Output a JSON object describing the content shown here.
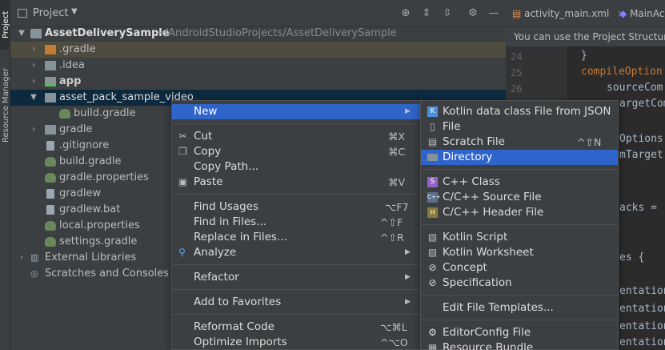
{
  "side_strip": {
    "project_tab": "Project",
    "resource_manager_tab": "Resource Manager"
  },
  "project_panel": {
    "title": "Project",
    "dropdown_icon": "chevron-down-icon",
    "header_icons": [
      "locate-icon",
      "expand-all-icon",
      "collapse-all-icon",
      "gear-icon",
      "hide-icon"
    ],
    "root": {
      "label": "AssetDeliverySample",
      "path": "~/AndroidStudioProjects/AssetDeliverySample"
    },
    "items": [
      {
        "label": ".gradle",
        "icon": "folder-icon"
      },
      {
        "label": ".idea",
        "icon": "folder-icon"
      },
      {
        "label": "app",
        "icon": "module-folder-icon"
      },
      {
        "label": "asset_pack_sample_video",
        "icon": "folder-icon"
      },
      {
        "label": "build.gradle",
        "icon": "gradle-icon"
      },
      {
        "label": "gradle",
        "icon": "folder-icon"
      },
      {
        "label": ".gitignore",
        "icon": "file-icon"
      },
      {
        "label": "build.gradle",
        "icon": "gradle-icon"
      },
      {
        "label": "gradle.properties",
        "icon": "gradle-icon"
      },
      {
        "label": "gradlew",
        "icon": "file-icon"
      },
      {
        "label": "gradlew.bat",
        "icon": "file-icon"
      },
      {
        "label": "local.properties",
        "icon": "gradle-icon"
      },
      {
        "label": "settings.gradle",
        "icon": "gradle-icon"
      },
      {
        "label": "External Libraries",
        "icon": "libraries-icon"
      },
      {
        "label": "Scratches and Consoles",
        "icon": "scratches-icon"
      }
    ]
  },
  "editor": {
    "tabs": [
      {
        "label": "activity_main.xml",
        "icon": "xml-icon"
      },
      {
        "label": "MainAc",
        "icon": "kotlin-icon"
      }
    ],
    "banner": "You can use the Project Structure",
    "line_numbers": [
      "24",
      "25",
      "26"
    ],
    "code_lines": [
      "}",
      "compileOption",
      "sourceCom",
      "argetCom",
      "Options",
      "mTarget",
      "acks = [",
      "es {",
      "entation",
      "entation",
      "entation",
      "entation"
    ]
  },
  "context_menu": {
    "items": [
      {
        "label": "New",
        "shortcut": "",
        "submenu": true,
        "selected": true
      },
      {
        "label": "Cut",
        "shortcut": "⌘X",
        "icon": "scissors-icon"
      },
      {
        "label": "Copy",
        "shortcut": "⌘C",
        "icon": "copy-icon"
      },
      {
        "label": "Copy Path...",
        "shortcut": ""
      },
      {
        "label": "Paste",
        "shortcut": "⌘V",
        "icon": "paste-icon"
      },
      {
        "label": "Find Usages",
        "shortcut": "⌥F7"
      },
      {
        "label": "Find in Files...",
        "shortcut": "^⇧F"
      },
      {
        "label": "Replace in Files...",
        "shortcut": "^⇧R"
      },
      {
        "label": "Analyze",
        "shortcut": "",
        "submenu": true,
        "icon": "analyze-icon"
      },
      {
        "label": "Refactor",
        "shortcut": "",
        "submenu": true
      },
      {
        "label": "Add to Favorites",
        "shortcut": "",
        "submenu": true
      },
      {
        "label": "Reformat Code",
        "shortcut": "⌥⌘L"
      },
      {
        "label": "Optimize Imports",
        "shortcut": "^⌥O"
      }
    ]
  },
  "new_submenu": {
    "items": [
      {
        "label": "Kotlin data class File from JSON",
        "shortcut": "",
        "icon": "kotlin-json-icon"
      },
      {
        "label": "File",
        "shortcut": "",
        "icon": "file-icon"
      },
      {
        "label": "Scratch File",
        "shortcut": "^⇧N",
        "icon": "scratch-file-icon"
      },
      {
        "label": "Directory",
        "shortcut": "",
        "icon": "folder-icon",
        "selected": true
      },
      {
        "label": "C++ Class",
        "shortcut": "",
        "icon": "cpp-class-icon"
      },
      {
        "label": "C/C++ Source File",
        "shortcut": "",
        "icon": "cpp-source-icon"
      },
      {
        "label": "C/C++ Header File",
        "shortcut": "",
        "icon": "cpp-header-icon"
      },
      {
        "label": "Kotlin Script",
        "shortcut": "",
        "icon": "kotlin-script-icon"
      },
      {
        "label": "Kotlin Worksheet",
        "shortcut": "",
        "icon": "kotlin-worksheet-icon"
      },
      {
        "label": "Concept",
        "shortcut": "",
        "icon": "concept-icon"
      },
      {
        "label": "Specification",
        "shortcut": "",
        "icon": "specification-icon"
      },
      {
        "label": "Edit File Templates...",
        "shortcut": ""
      },
      {
        "label": "EditorConfig File",
        "shortcut": "",
        "icon": "editorconfig-icon"
      },
      {
        "label": "Resource Bundle",
        "shortcut": "",
        "icon": "resource-bundle-icon"
      }
    ]
  },
  "colors": {
    "selection": "#2f65ca",
    "panel": "#3c3f41",
    "editor": "#2b2b2b",
    "text": "#bbbbbb",
    "gradle_row": "#4e4b3f",
    "selected_row": "#0d293e"
  }
}
